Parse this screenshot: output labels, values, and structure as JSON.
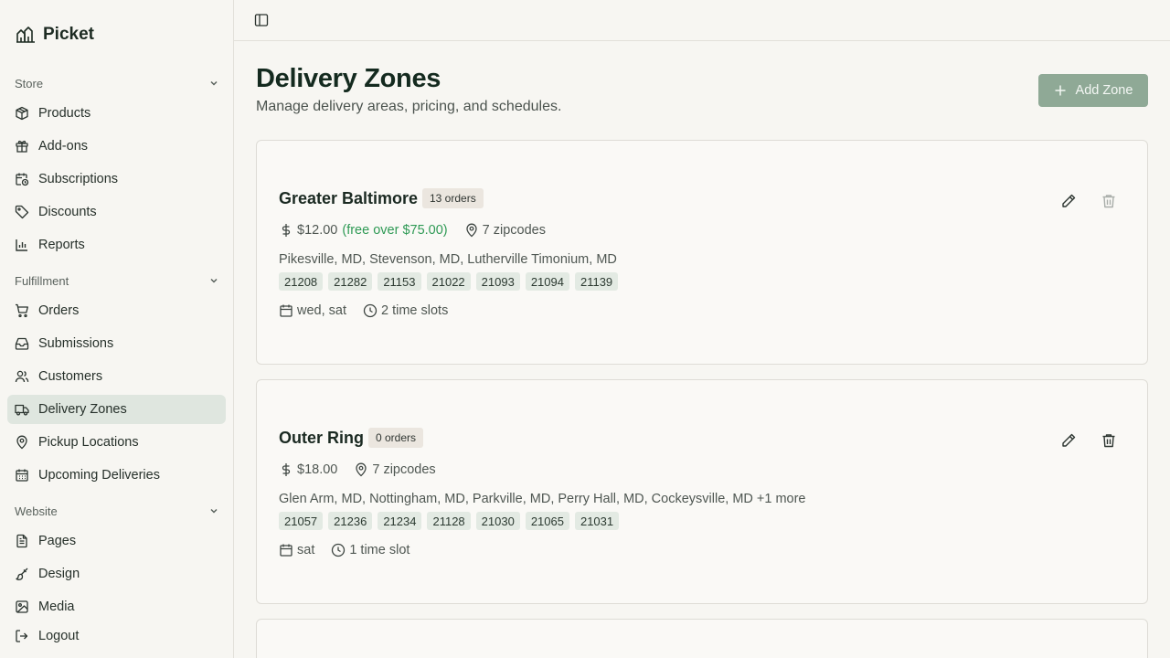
{
  "app": {
    "name": "Picket"
  },
  "sidebar": {
    "groups": [
      {
        "label": "Store",
        "items": [
          "Products",
          "Add-ons",
          "Subscriptions",
          "Discounts",
          "Reports"
        ]
      },
      {
        "label": "Fulfillment",
        "items": [
          "Orders",
          "Submissions",
          "Customers",
          "Delivery Zones",
          "Pickup Locations",
          "Upcoming Deliveries"
        ]
      },
      {
        "label": "Website",
        "items": [
          "Pages",
          "Design",
          "Media"
        ]
      }
    ],
    "logout": "Logout",
    "active_item": "Delivery Zones"
  },
  "page": {
    "title": "Delivery Zones",
    "subtitle": "Manage delivery areas, pricing, and schedules.",
    "add_button": "Add Zone"
  },
  "zones": [
    {
      "name": "Greater Baltimore",
      "orders": "13 orders",
      "price": "$12.00",
      "free_note": "(free over $75.00)",
      "zipcode_count": "7 zipcodes",
      "cities": "Pikesville, MD, Stevenson, MD, Lutherville Timonium, MD",
      "zips": [
        "21208",
        "21282",
        "21153",
        "21022",
        "21093",
        "21094",
        "21139"
      ],
      "days": "wed, sat",
      "slots": "2 time slots",
      "delete_enabled": false
    },
    {
      "name": "Outer Ring",
      "orders": "0 orders",
      "price": "$18.00",
      "free_note": "",
      "zipcode_count": "7 zipcodes",
      "cities": "Glen Arm, MD, Nottingham, MD, Parkville, MD, Perry Hall, MD, Cockeysville, MD +1 more",
      "zips": [
        "21057",
        "21236",
        "21234",
        "21128",
        "21030",
        "21065",
        "21031"
      ],
      "days": "sat",
      "slots": "1 time slot",
      "delete_enabled": true
    }
  ],
  "colors": {
    "accent": "#8fa996",
    "active_nav": "#dfe6df",
    "free_text": "#2f9a55",
    "zip_chip": "#e3eae3"
  }
}
